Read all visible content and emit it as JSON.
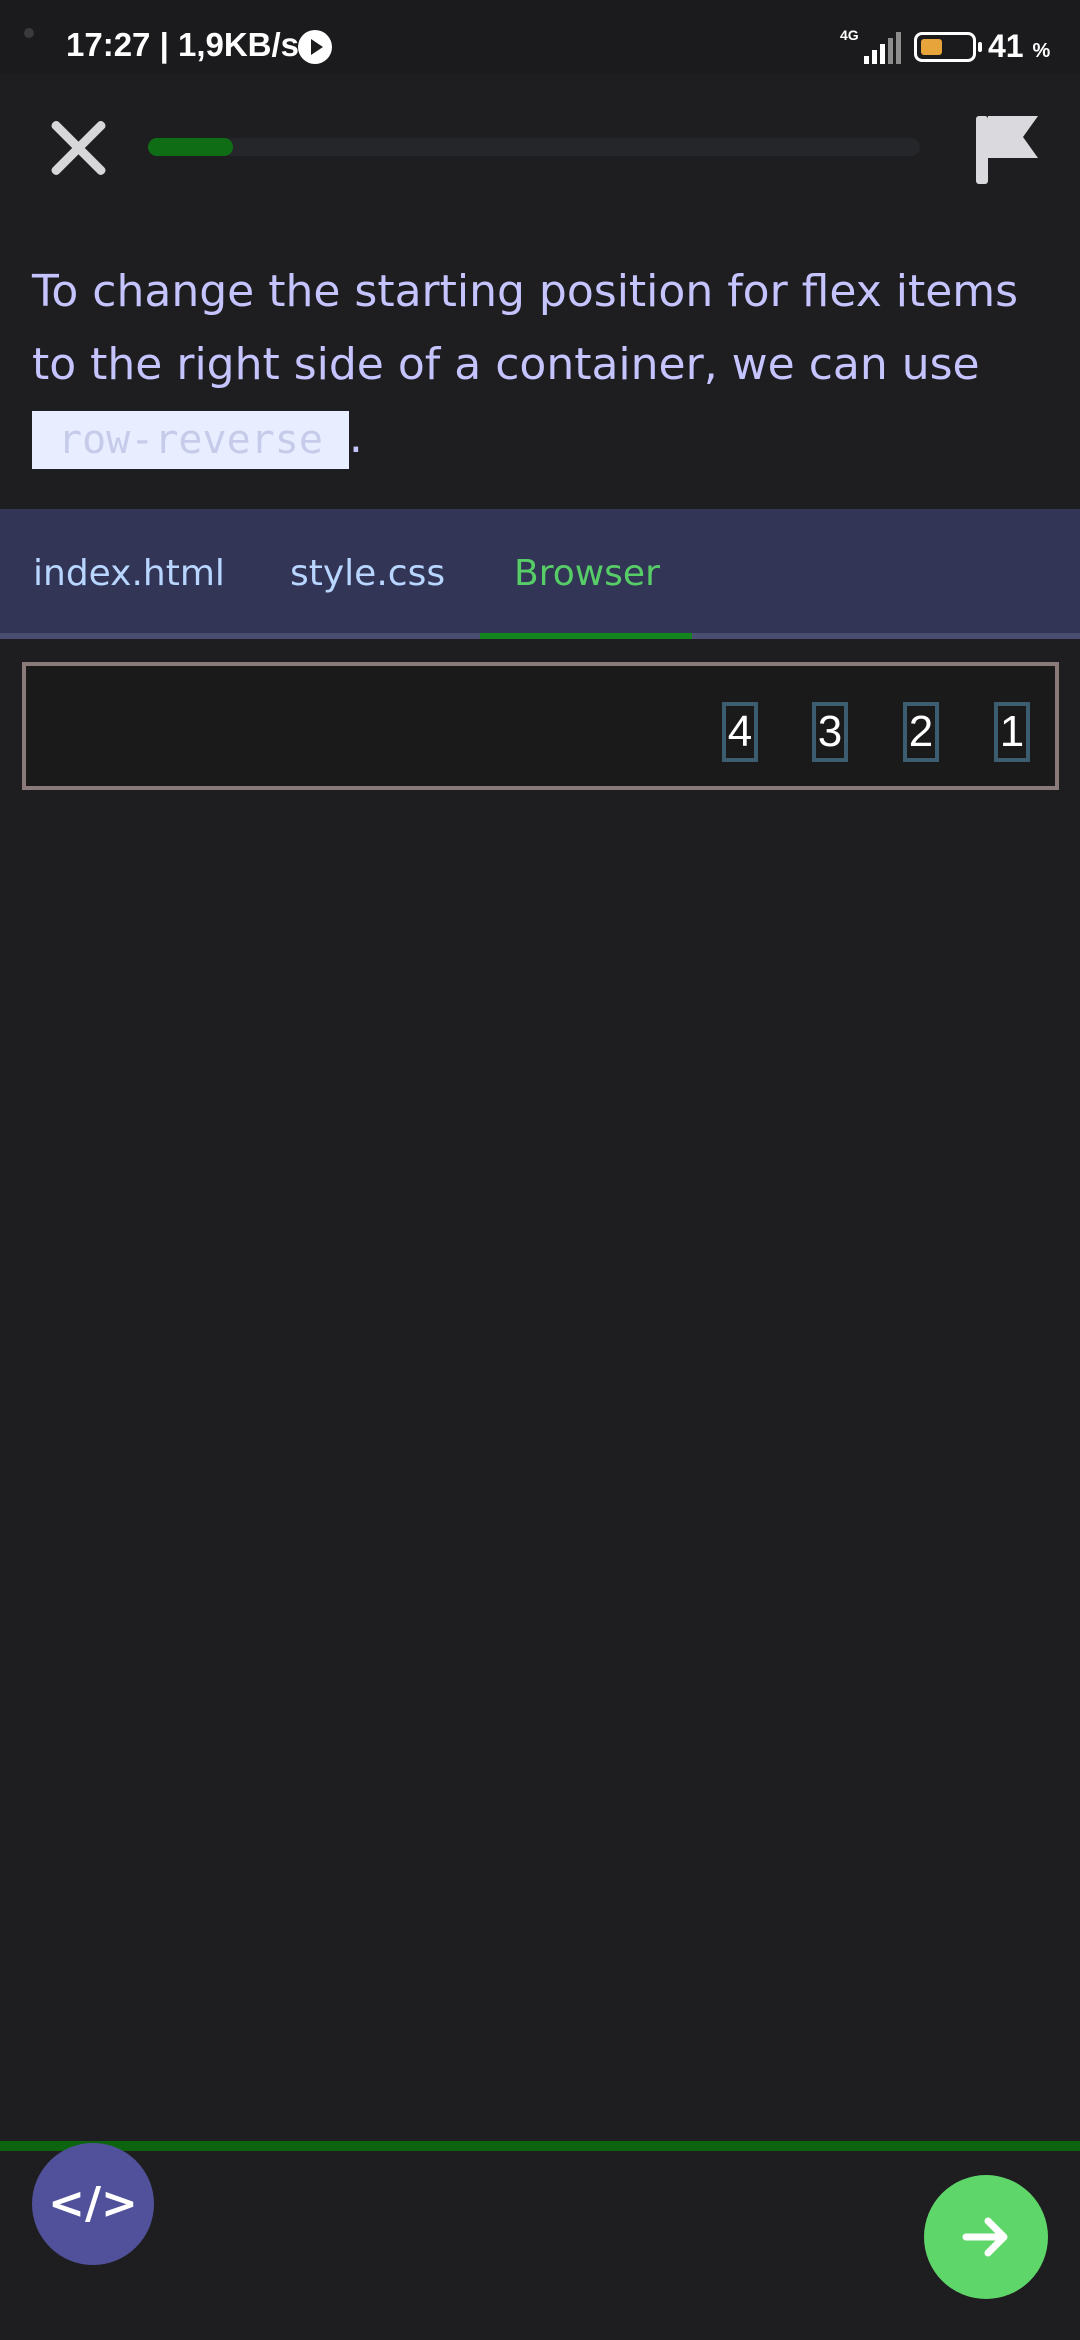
{
  "status_bar": {
    "time_speed": "17:27 | 1,9KB/s",
    "network": "4G",
    "battery_percent": "41",
    "battery_unit": "%",
    "battery_level": 0.41
  },
  "lesson": {
    "progress_fraction": 0.11,
    "instruction_text": "To change the starting position for flex items to the right side of a container, we can use",
    "code_term": "row-reverse",
    "trailing_punctuation": "."
  },
  "tabs": [
    {
      "label": "index.html",
      "active": false
    },
    {
      "label": "style.css",
      "active": false
    },
    {
      "label": "Browser",
      "active": true
    }
  ],
  "browser_preview": {
    "items": [
      "4",
      "3",
      "2",
      "1"
    ]
  },
  "bottom_bar": {
    "code_button_symbol": "</>",
    "next_icon": "arrow-right-icon"
  },
  "colors": {
    "accent_green": "#5fd66a",
    "tab_active": "#57cd67",
    "instruction_text": "#c6c4ff",
    "code_button": "#51519b"
  }
}
